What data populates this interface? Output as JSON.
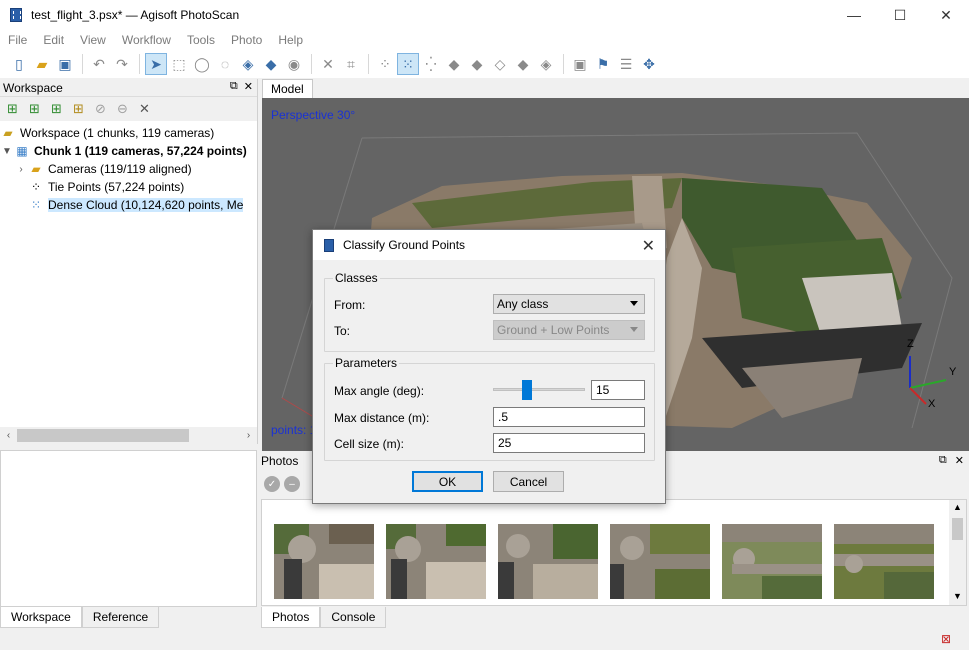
{
  "window": {
    "title": "test_flight_3.psx* — Agisoft PhotoScan",
    "minimize": "—",
    "maximize": "☐",
    "close": "✕"
  },
  "menu": [
    "File",
    "Edit",
    "View",
    "Workflow",
    "Tools",
    "Photo",
    "Help"
  ],
  "workspace": {
    "header": "Workspace",
    "tree": [
      {
        "label": "Workspace (1 chunks, 119 cameras)"
      },
      {
        "label": "Chunk 1 (119 cameras, 57,224 points)"
      },
      {
        "label": "Cameras (119/119 aligned)"
      },
      {
        "label": "Tie Points (57,224 points)"
      },
      {
        "label": "Dense Cloud (10,124,620 points, Me"
      }
    ]
  },
  "model": {
    "tab": "Model",
    "perspective": "Perspective 30°",
    "points_label": "points: 1",
    "axis_z": "Z",
    "axis_y": "Y",
    "axis_x": "X"
  },
  "photos": {
    "header": "Photos"
  },
  "bottom_tabs_left": [
    "Workspace",
    "Reference"
  ],
  "bottom_tabs_right": [
    "Photos",
    "Console"
  ],
  "dialog": {
    "title": "Classify Ground Points",
    "classes_group": "Classes",
    "from_label": "From:",
    "from_value": "Any class",
    "to_label": "To:",
    "to_value": "Ground + Low Points",
    "parameters_group": "Parameters",
    "max_angle_label": "Max angle (deg):",
    "max_angle_value": "15",
    "max_angle_slider_fraction": 0.35,
    "max_distance_label": "Max distance (m):",
    "max_distance_value": ".5",
    "cell_size_label": "Cell size (m):",
    "cell_size_value": "25",
    "ok": "OK",
    "cancel": "Cancel"
  },
  "colors": {
    "accent": "#0078d7",
    "viewport_bg": "#646464",
    "overlay_text": "#1a32d4"
  }
}
